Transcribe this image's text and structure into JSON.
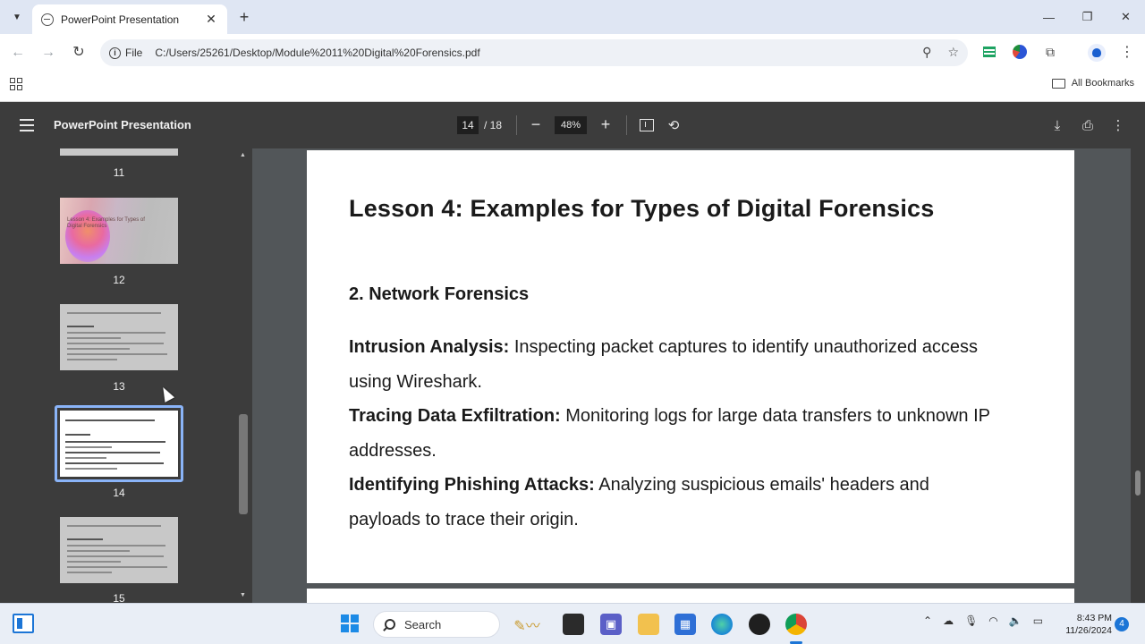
{
  "browser": {
    "tab_title": "PowerPoint Presentation",
    "tab_close": "✕",
    "new_tab": "+",
    "window_controls": {
      "minimize": "—",
      "maximize": "❐",
      "close": "✕"
    },
    "nav": {
      "back": "←",
      "forward": "→",
      "reload": "↻"
    },
    "site_chip": "File",
    "url": "C:/Users/25261/Desktop/Module%2011%20Digital%20Forensics.pdf",
    "bookmarks_label": "All Bookmarks"
  },
  "pdf_viewer": {
    "title": "PowerPoint Presentation",
    "current_page": "14",
    "total_pages": "/ 18",
    "zoom": "48%",
    "zoom_out": "−",
    "zoom_in": "+",
    "thumbnails": [
      {
        "label": "11"
      },
      {
        "label": "12",
        "text": "Lesson 4: Examples for Types of Digital Forensics"
      },
      {
        "label": "13"
      },
      {
        "label": "14",
        "selected": true
      },
      {
        "label": "15"
      }
    ]
  },
  "slide": {
    "title": "Lesson 4: Examples for Types of Digital Forensics",
    "section": "2. Network Forensics",
    "items": [
      {
        "term": "Intrusion Analysis:",
        "text": " Inspecting packet captures to identify unauthorized access using Wireshark."
      },
      {
        "term": "Tracing Data Exfiltration:",
        "text": " Monitoring logs for large data transfers to unknown IP addresses."
      },
      {
        "term": "Identifying Phishing Attacks:",
        "text": " Analyzing suspicious emails' headers and payloads to trace their origin."
      }
    ]
  },
  "taskbar": {
    "search_placeholder": "Search",
    "time": "8:43 PM",
    "date": "11/26/2024",
    "notification_count": "4"
  },
  "colors": {
    "pdf_toolbar": "#3c3c3c",
    "viewer_bg": "#525659",
    "selection": "#8ab4f8",
    "accent": "#1c75d6"
  }
}
